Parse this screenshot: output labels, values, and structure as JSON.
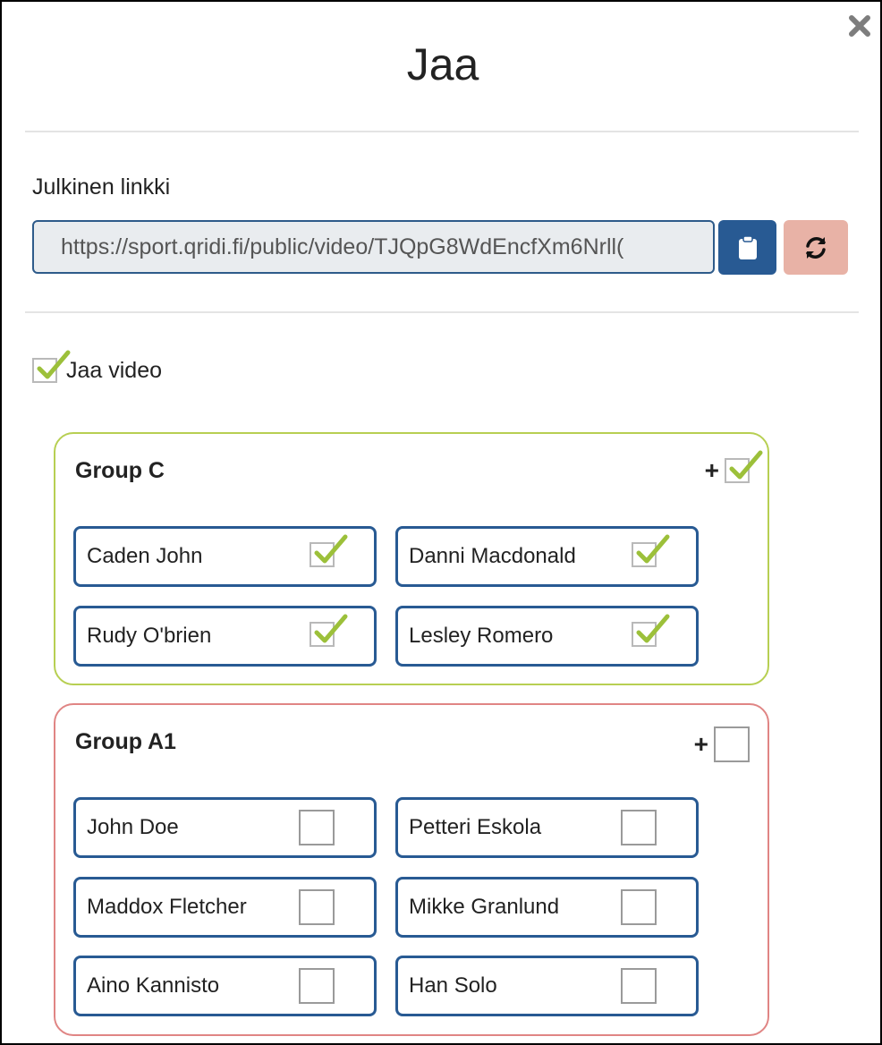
{
  "dialog": {
    "title": "Jaa",
    "close_icon": "close-icon"
  },
  "public_link": {
    "label": "Julkinen linkki",
    "url": "https://sport.qridi.fi/public/video/TJQpG8WdEncfXm6Nrll(",
    "copy_icon": "clipboard-icon",
    "refresh_icon": "refresh-icon",
    "copy_color": "#285a93",
    "refresh_color": "#e8b2a6"
  },
  "share_video": {
    "label": "Jaa video",
    "checked": true
  },
  "groups": [
    {
      "name": "Group C",
      "add_label": "+",
      "checked": true,
      "border_color": "#b7cf52",
      "members": [
        {
          "name": "Caden John",
          "checked": true
        },
        {
          "name": "Danni Macdonald",
          "checked": true
        },
        {
          "name": "Rudy O'brien",
          "checked": true
        },
        {
          "name": "Lesley Romero",
          "checked": true
        }
      ]
    },
    {
      "name": "Group A1",
      "add_label": "+",
      "checked": false,
      "border_color": "#e08584",
      "members": [
        {
          "name": "John Doe",
          "checked": false
        },
        {
          "name": "Petteri Eskola",
          "checked": false
        },
        {
          "name": "Maddox Fletcher",
          "checked": false
        },
        {
          "name": "Mikke Granlund",
          "checked": false
        },
        {
          "name": "Aino Kannisto",
          "checked": false
        },
        {
          "name": "Han Solo",
          "checked": false
        }
      ]
    }
  ],
  "colors": {
    "check_green": "#9cc03a",
    "member_border": "#285a93"
  }
}
